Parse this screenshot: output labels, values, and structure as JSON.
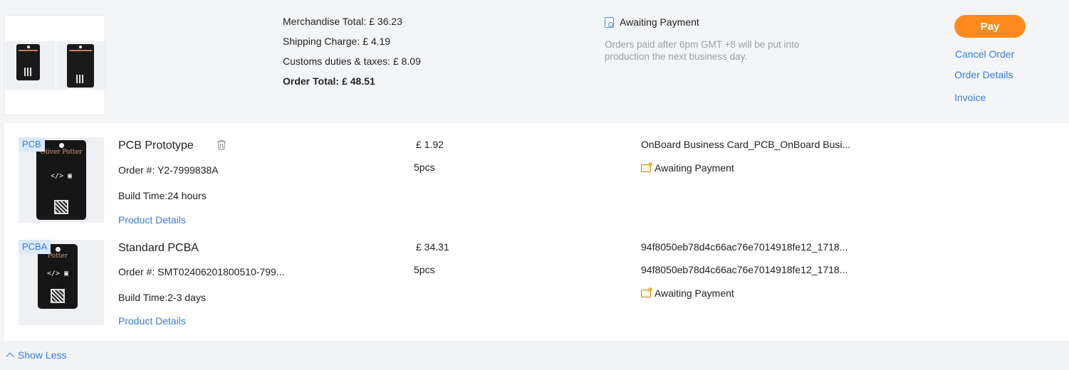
{
  "summary": {
    "merchandise_label": "Merchandise Total:",
    "merchandise_value": "£ 36.23",
    "shipping_label": "Shipping Charge:",
    "shipping_value": "£ 4.19",
    "customs_label": "Customs duties & taxes:",
    "customs_value": "£ 8.09",
    "order_total_label": "Order Total:",
    "order_total_value": "£ 48.51"
  },
  "status": {
    "icon": "document-search-icon",
    "title": "Awaiting Payment",
    "note": "Orders paid after 6pm GMT +8 will be put into production the next business day."
  },
  "actions": {
    "pay": "Pay",
    "cancel": "Cancel Order",
    "details": "Order Details",
    "invoice": "Invoice"
  },
  "items": [
    {
      "tag": "PCB",
      "card_name": "Oliver Potter",
      "name": "PCB Prototype",
      "order_no": "Order #:  Y2-7999838A",
      "build_time": "Build Time:24 hours",
      "details_link": "Product Details",
      "price": "£ 1.92",
      "qty": "5pcs",
      "file": "OnBoard Business Card_PCB_OnBoard Busi...",
      "status": "Awaiting Payment"
    },
    {
      "tag": "PCBA",
      "card_name": "Potter",
      "name": "Standard PCBA",
      "order_no": "Order #:  SMT02406201800510-799...",
      "build_time": "Build Time:2-3 days",
      "details_link": "Product Details",
      "price": "£ 34.31",
      "qty": "5pcs",
      "file1": "94f8050eb78d4c66ac76e7014918fe12_1718...",
      "file2": "94f8050eb78d4c66ac76e7014918fe12_1718...",
      "status": "Awaiting Payment"
    }
  ],
  "footer": {
    "show_less": "Show Less"
  },
  "colors": {
    "accent": "#3a7dd8",
    "pay_button": "#ff8a1d",
    "tag_bg": "#dbe9fb"
  }
}
